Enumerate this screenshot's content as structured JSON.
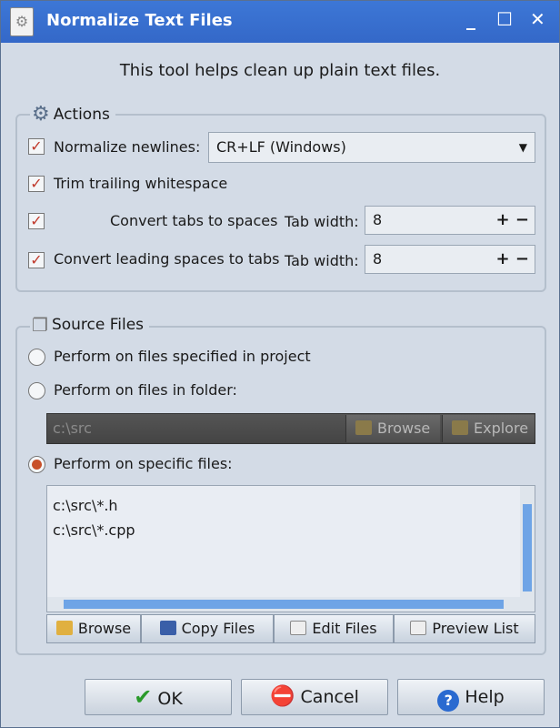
{
  "window": {
    "title": "Normalize Text Files",
    "minimize": "_",
    "maximize": "☐",
    "close": "✕"
  },
  "intro": "This tool helps clean up plain text files.",
  "actions": {
    "legend": "Actions",
    "normalize_newlines": {
      "label": "Normalize newlines:",
      "checked": true,
      "value": "CR+LF (Windows)"
    },
    "trim": {
      "label": "Trim trailing whitespace",
      "checked": true
    },
    "tabs_to_spaces": {
      "label": "Convert tabs to spaces",
      "checked": true,
      "tab_label": "Tab width:",
      "value": "8"
    },
    "spaces_to_tabs": {
      "label": "Convert leading spaces to tabs",
      "checked": true,
      "tab_label": "Tab width:",
      "value": "8"
    },
    "plus": "+",
    "minus": "−"
  },
  "source": {
    "legend": "Source Files",
    "opt_project": "Perform on files specified in project",
    "opt_folder": "Perform on files in folder:",
    "folder_value": "c:\\src",
    "folder_browse": "Browse",
    "folder_explore": "Explore",
    "opt_specific": "Perform on specific files:",
    "selected": "specific",
    "files": [
      "c:\\src\\*.h",
      "c:\\src\\*.cpp"
    ],
    "buttons": {
      "browse": "Browse",
      "copy": "Copy Files",
      "edit": "Edit Files",
      "preview": "Preview List"
    }
  },
  "footer": {
    "ok": "OK",
    "cancel": "Cancel",
    "help": "Help"
  }
}
